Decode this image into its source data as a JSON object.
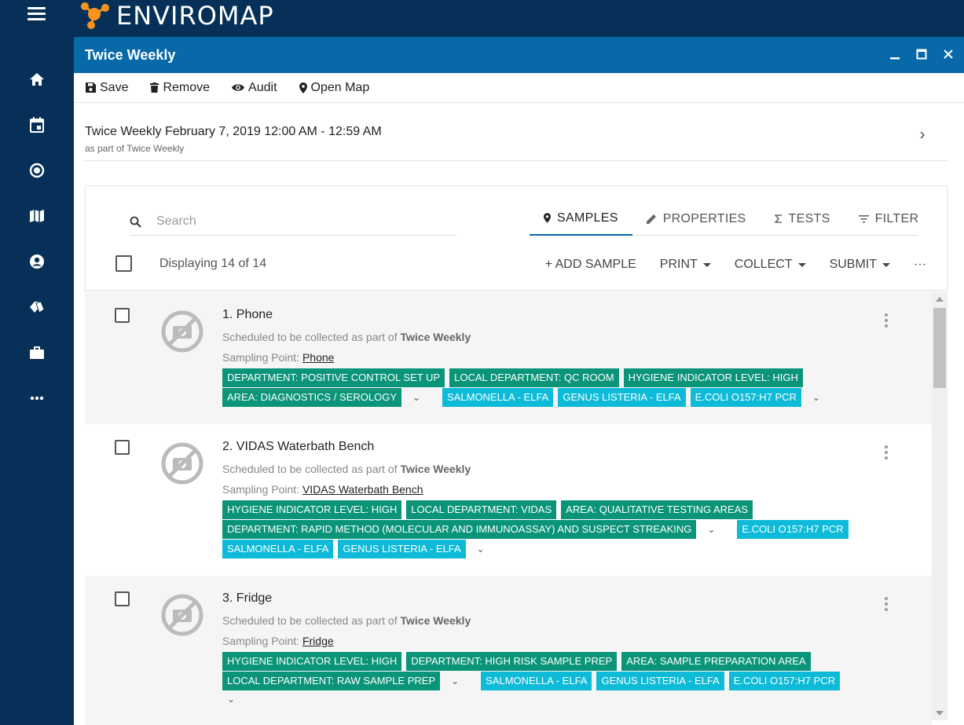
{
  "app": {
    "name": "ENVIROMAP"
  },
  "nav": {
    "items": [
      {
        "icon": "home-icon"
      },
      {
        "icon": "calendar-icon"
      },
      {
        "icon": "target-icon"
      },
      {
        "icon": "map-icon"
      },
      {
        "icon": "account-icon"
      },
      {
        "icon": "tags-icon"
      },
      {
        "icon": "briefcase-icon"
      },
      {
        "icon": "more-icon"
      }
    ]
  },
  "window": {
    "title": "Twice Weekly",
    "controls": {
      "minimize": "minimize-icon",
      "maximize": "maximize-icon",
      "close": "close-icon"
    }
  },
  "toolbar": {
    "save": "Save",
    "remove": "Remove",
    "audit": "Audit",
    "open_map": "Open Map"
  },
  "event": {
    "title": "Twice Weekly February 7, 2019 12:00 AM - 12:59 AM",
    "subtitle": "as part of Twice Weekly"
  },
  "search": {
    "placeholder": "Search",
    "value": ""
  },
  "tabs": [
    {
      "label": "SAMPLES",
      "icon": "pin-icon",
      "active": true
    },
    {
      "label": "PROPERTIES",
      "icon": "pencil-icon",
      "active": false
    },
    {
      "label": "TESTS",
      "icon": "sigma-icon",
      "active": false
    },
    {
      "label": "FILTER",
      "icon": "filter-icon",
      "active": false
    }
  ],
  "list_header": {
    "count_text": "Displaying 14 of 14",
    "add_sample": "+ ADD SAMPLE",
    "print": "PRINT",
    "collect": "COLLECT",
    "submit": "SUBMIT",
    "more": "···"
  },
  "samples": [
    {
      "title": "1. Phone",
      "sched_prefix": "Scheduled to be collected as part of",
      "sched_plan": "Twice Weekly",
      "sp_label": "Sampling Point:",
      "sp_value": "Phone",
      "row1": [
        "DEPARTMENT: POSITIVE CONTROL SET UP",
        "LOCAL DEPARTMENT: QC ROOM",
        "HYGIENE INDICATOR LEVEL: HIGH"
      ],
      "row2_props": [
        "AREA: DIAGNOSTICS / SEROLOGY"
      ],
      "row2_tests": [
        "SALMONELLA - ELFA",
        "GENUS LISTERIA - ELFA",
        "E.COLI O157:H7 PCR"
      ]
    },
    {
      "title": "2. VIDAS Waterbath Bench",
      "sched_prefix": "Scheduled to be collected as part of",
      "sched_plan": "Twice Weekly",
      "sp_label": "Sampling Point:",
      "sp_value": "VIDAS Waterbath Bench",
      "row1": [
        "HYGIENE INDICATOR LEVEL: HIGH",
        "LOCAL DEPARTMENT: VIDAS",
        "AREA: QUALITATIVE TESTING AREAS"
      ],
      "row2_props": [
        "DEPARTMENT: RAPID METHOD (MOLECULAR AND IMMUNOASSAY) AND SUSPECT STREAKING"
      ],
      "row2_tests": [
        "E.COLI O157:H7 PCR"
      ],
      "row3_tests": [
        "SALMONELLA - ELFA",
        "GENUS LISTERIA - ELFA"
      ]
    },
    {
      "title": "3. Fridge",
      "sched_prefix": "Scheduled to be collected as part of",
      "sched_plan": "Twice Weekly",
      "sp_label": "Sampling Point:",
      "sp_value": "Fridge",
      "row1": [
        "HYGIENE INDICATOR LEVEL: HIGH",
        "DEPARTMENT: HIGH RISK SAMPLE PREP",
        "AREA: SAMPLE PREPARATION AREA"
      ],
      "row2_props": [
        "LOCAL DEPARTMENT: RAW SAMPLE PREP"
      ],
      "row2_tests": [
        "SALMONELLA - ELFA",
        "GENUS LISTERIA - ELFA",
        "E.COLI O157:H7 PCR"
      ]
    }
  ]
}
